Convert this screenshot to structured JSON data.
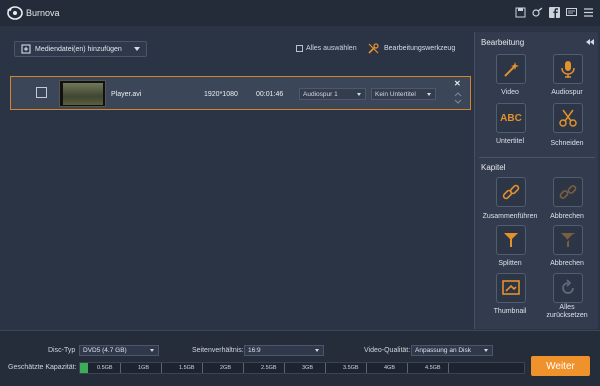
{
  "app": {
    "title": "Burnova"
  },
  "titlebar": {
    "icons": [
      "save-icon",
      "key-icon",
      "facebook-icon",
      "feedback-icon",
      "menu-icon"
    ]
  },
  "toolbar": {
    "add_media_label": "Mediendatei(en) hinzufügen",
    "select_all_label": "Alles auswählen",
    "edit_tool_label": "Bearbeitungswerkzeug"
  },
  "media": {
    "items": [
      {
        "file_name": "Player.avi",
        "resolution": "1920*1080",
        "duration": "00:01:46",
        "audio_track": "Audiospur 1",
        "subtitle": "Kein Untertitel"
      }
    ]
  },
  "panel": {
    "edit_title": "Bearbeitung",
    "edit_tools": [
      {
        "label": "Video",
        "icon": "magic-wand-icon"
      },
      {
        "label": "Audiospur",
        "icon": "microphone-icon"
      },
      {
        "label": "Untertitel",
        "icon": "abc-icon",
        "glyph": "ABC"
      },
      {
        "label": "Schneiden",
        "icon": "scissors-icon"
      }
    ],
    "chapter_title": "Kapitel",
    "chapter_tools": [
      {
        "label": "Zusammenführen",
        "icon": "chain-link-icon"
      },
      {
        "label": "Abbrechen",
        "icon": "broken-link-icon"
      },
      {
        "label": "Splitten",
        "icon": "split-icon"
      },
      {
        "label": "Abbrechen",
        "icon": "cancel-split-icon"
      },
      {
        "label": "Thumbnail",
        "icon": "thumbnail-icon"
      },
      {
        "label": "Alles zurücksetzen",
        "icon": "reset-icon"
      }
    ]
  },
  "bottom": {
    "disc_type_label": "Disc-Typ",
    "disc_type_value": "DVD5 (4.7 GB)",
    "aspect_label": "Seitenverhältnis:",
    "aspect_value": "16:9",
    "quality_label": "Video-Qualität:",
    "quality_value": "Anpassung an Disk",
    "capacity_label": "Geschätzte Kapazität:",
    "capacity_fill_gb": 0.09,
    "capacity_ticks": [
      "0.5GB",
      "1GB",
      "1.5GB",
      "2GB",
      "2.5GB",
      "3GB",
      "3.5GB",
      "4GB",
      "4.5GB"
    ],
    "next_label": "Weiter"
  },
  "colors": {
    "accent": "#f0922c",
    "selection_border": "#d4852c",
    "capacity_fill": "#3cae5a"
  }
}
